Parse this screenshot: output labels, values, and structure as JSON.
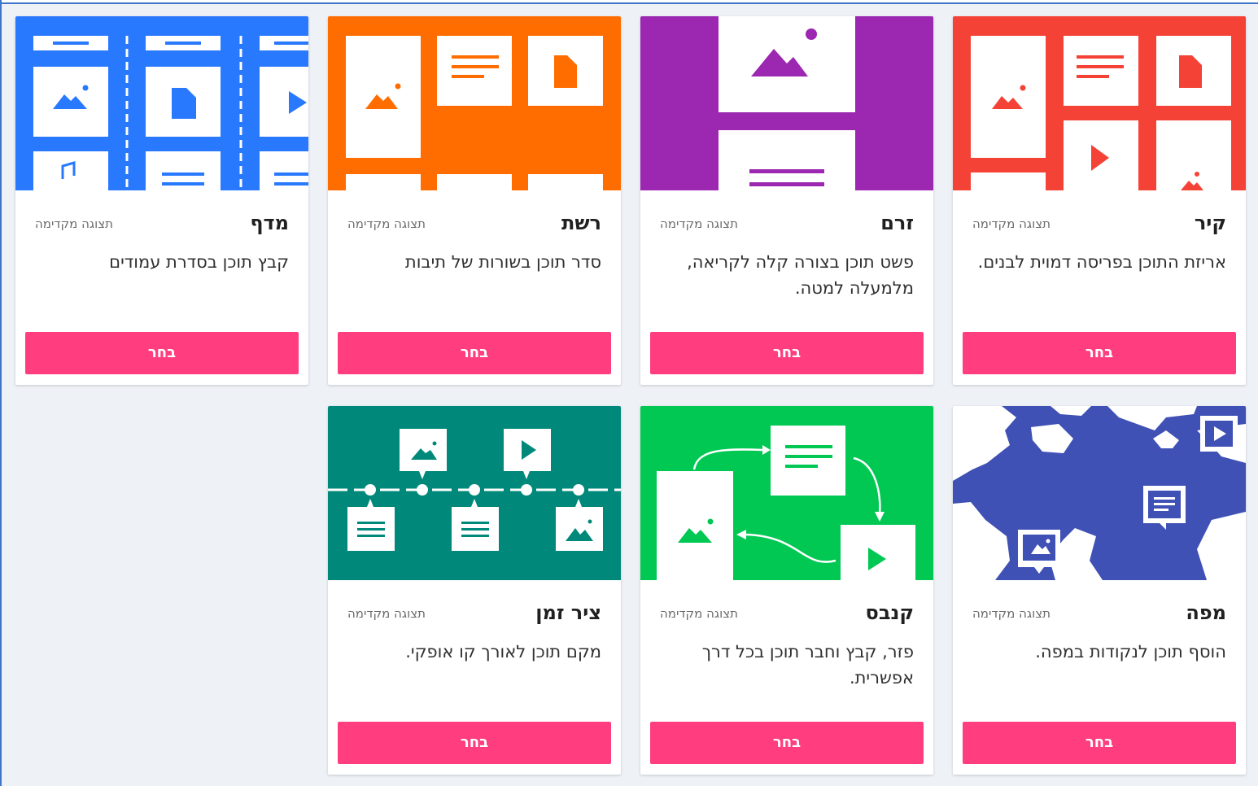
{
  "layouts": [
    {
      "title": "קיר",
      "preview_label": "תצוגה מקדימה",
      "description": "אריזת התוכן בפריסה דמוית לבנים.",
      "button_label": "בחר",
      "color": "#f44336",
      "icon": "wall-layout-icon"
    },
    {
      "title": "זרם",
      "preview_label": "תצוגה מקדימה",
      "description": "פשט תוכן בצורה קלה לקריאה, מלמעלה למטה.",
      "button_label": "בחר",
      "color": "#9c27b0",
      "icon": "stream-layout-icon"
    },
    {
      "title": "רשת",
      "preview_label": "תצוגה מקדימה",
      "description": "סדר תוכן בשורות של תיבות",
      "button_label": "בחר",
      "color": "#ff6d00",
      "icon": "grid-layout-icon"
    },
    {
      "title": "מדף",
      "preview_label": "תצוגה מקדימה",
      "description": "קבץ תוכן בסדרת עמודים",
      "button_label": "בחר",
      "color": "#2979ff",
      "icon": "shelf-layout-icon"
    },
    {
      "title": "מפה",
      "preview_label": "תצוגה מקדימה",
      "description": "הוסף תוכן לנקודות במפה.",
      "button_label": "בחר",
      "color": "#3f51b5",
      "icon": "map-layout-icon"
    },
    {
      "title": "קנבס",
      "preview_label": "תצוגה מקדימה",
      "description": "פזר, קבץ וחבר תוכן בכל דרך אפשרית.",
      "button_label": "בחר",
      "color": "#00c853",
      "icon": "canvas-layout-icon"
    },
    {
      "title": "ציר זמן",
      "preview_label": "תצוגה מקדימה",
      "description": "מקם תוכן לאורך קו אופקי.",
      "button_label": "בחר",
      "color": "#00897b",
      "icon": "timeline-layout-icon"
    }
  ]
}
